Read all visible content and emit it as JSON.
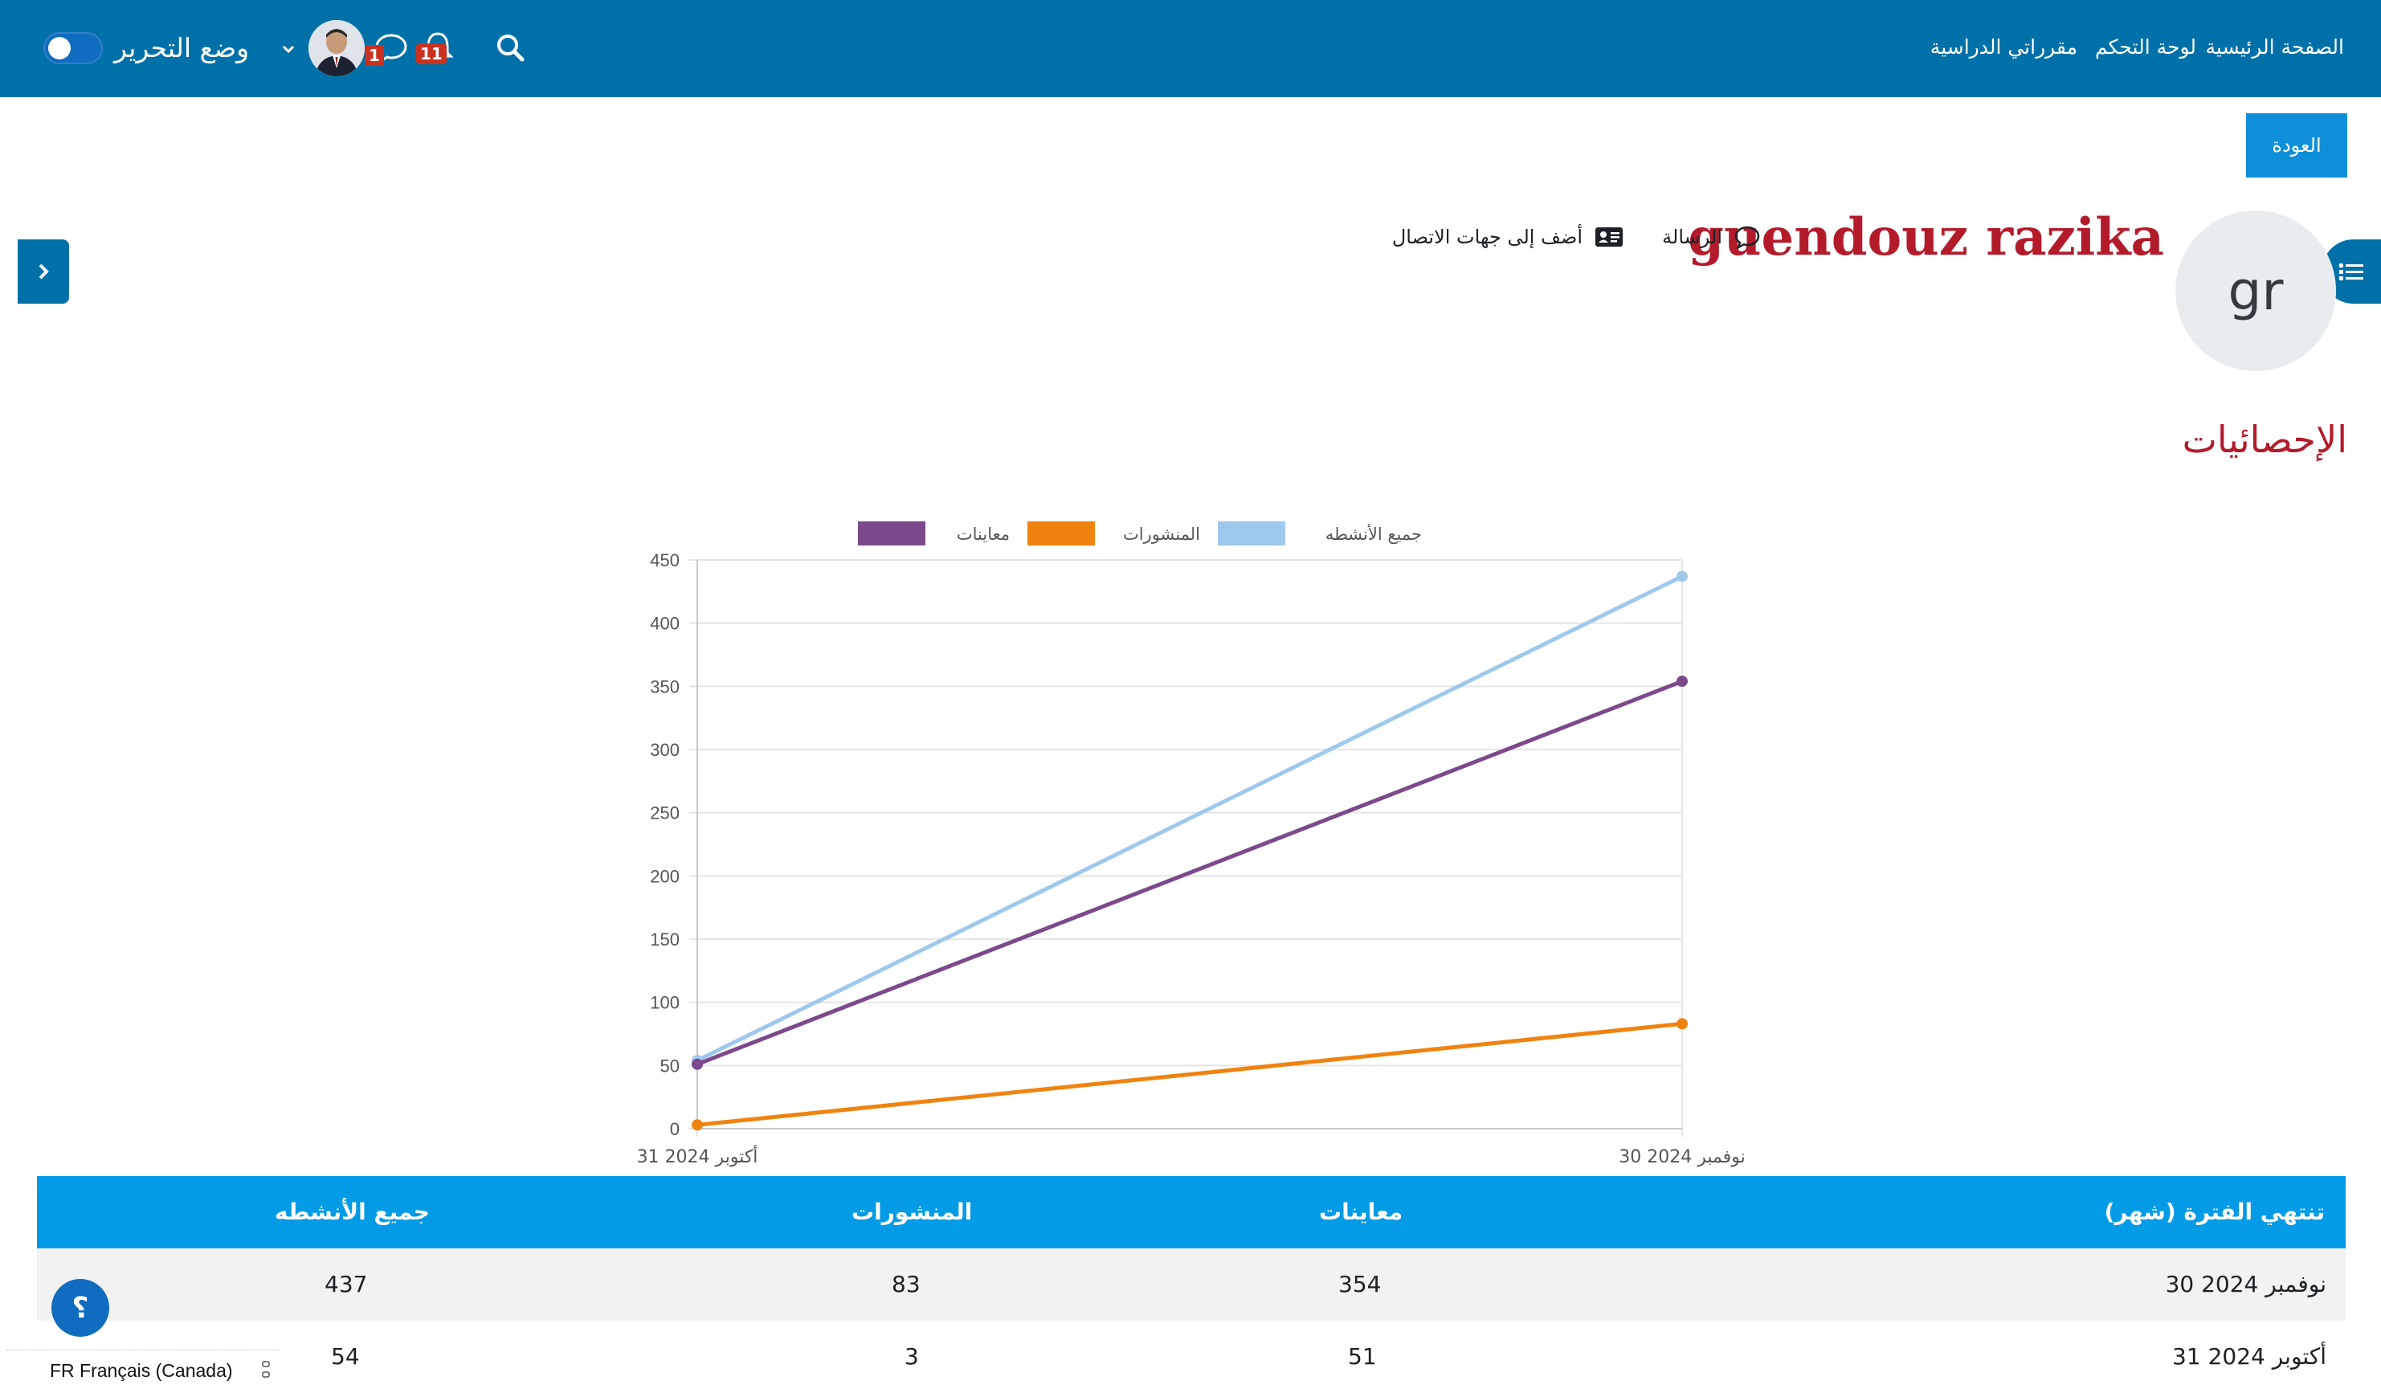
{
  "nav": {
    "home": "الصفحة الرئيسية",
    "dashboard": "لوحة التحكم",
    "my_courses": "مقرراتي الدراسية",
    "notifications_count": "11",
    "messages_count": "1",
    "edit_mode_label": "وضع التحرير"
  },
  "page": {
    "back_button": "العودة",
    "avatar_initials": "gr",
    "profile_name": "guendouz razika",
    "message_link": "الرسالة",
    "add_contact_link": "أضف إلى جهات الاتصال",
    "section_title": "الإحصائيات"
  },
  "chart_data": {
    "type": "line",
    "categories": [
      "31 أكتوبر 2024",
      "30 نوفمبر 2024"
    ],
    "series": [
      {
        "name": "جميع الأنشطه",
        "values": [
          54,
          437
        ],
        "color": "#9fc9ec"
      },
      {
        "name": "المنشورات",
        "values": [
          3,
          83
        ],
        "color": "#f0830f"
      },
      {
        "name": "معاينات",
        "values": [
          51,
          354
        ],
        "color": "#7c4a8c"
      }
    ],
    "ylim": [
      0,
      450
    ],
    "yticks": [
      "0",
      "50",
      "100",
      "150",
      "200",
      "250",
      "300",
      "350",
      "400",
      "450"
    ],
    "grid": true,
    "legend": "top"
  },
  "table": {
    "headers": {
      "period": "تنتهي الفترة (شهر)",
      "views": "معاينات",
      "posts": "المنشورات",
      "all": "جميع الأنشطه"
    },
    "rows": [
      {
        "period": "30 نوفمبر 2024",
        "views": "354",
        "posts": "83",
        "all": "437"
      },
      {
        "period": "31 أكتوبر 2024",
        "views": "51",
        "posts": "3",
        "all": "54"
      }
    ]
  },
  "footer": {
    "language": "FR Français (Canada)",
    "help": "؟"
  }
}
